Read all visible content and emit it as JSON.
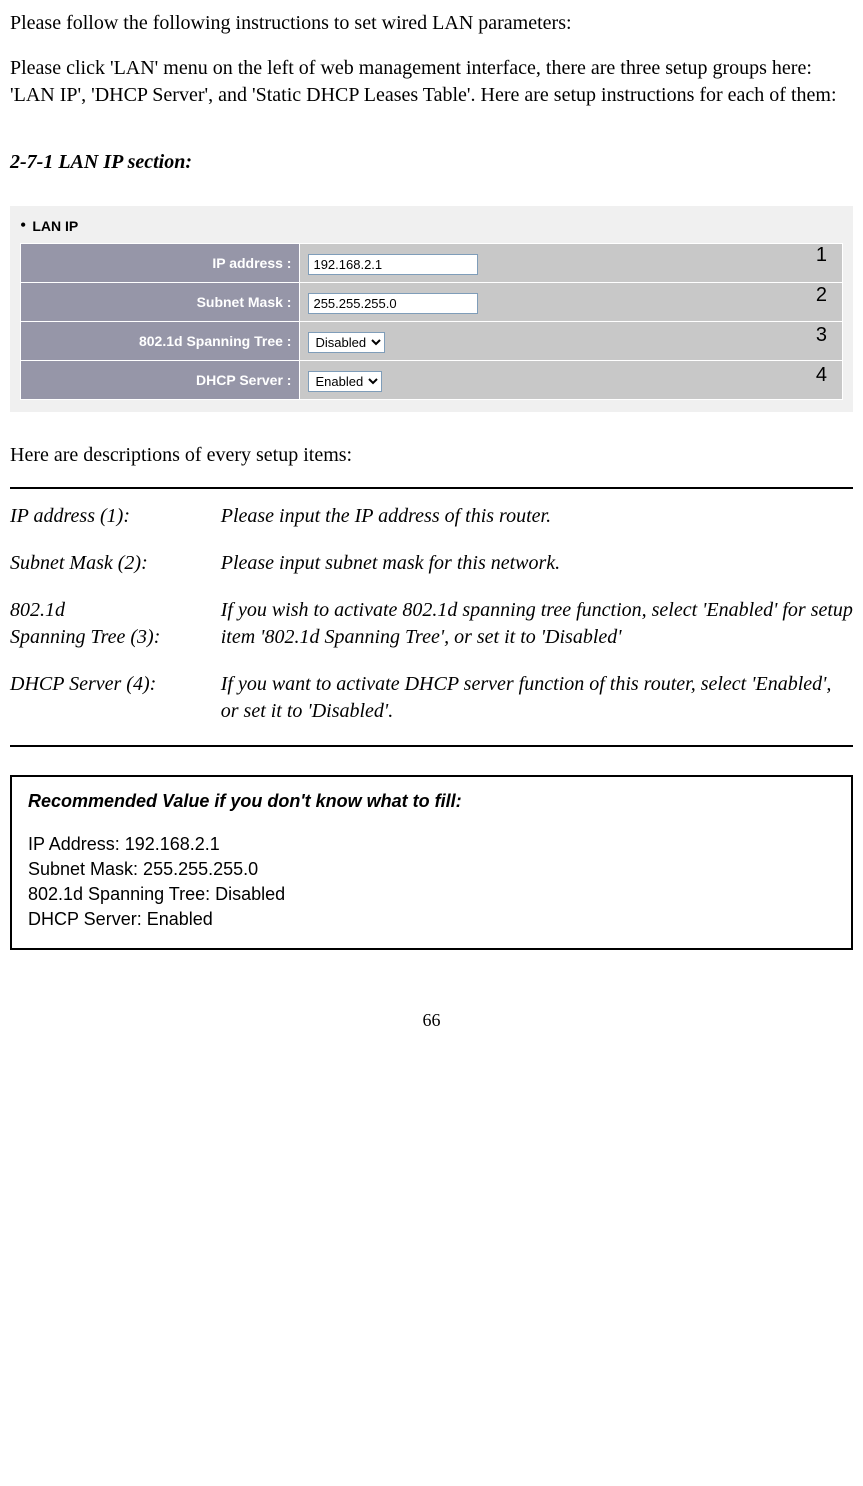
{
  "intro1": "Please follow the following instructions to set wired LAN parameters:",
  "intro2": "Please click 'LAN' menu on the left of web management interface, there are three setup groups here: 'LAN IP', 'DHCP Server', and 'Static DHCP Leases Table'. Here are setup instructions for each of them:",
  "section_heading": "2-7-1 LAN IP section:",
  "screenshot": {
    "heading": "LAN IP",
    "rows": [
      {
        "label": "IP address :",
        "type": "text",
        "value": "192.168.2.1"
      },
      {
        "label": "Subnet Mask :",
        "type": "text",
        "value": "255.255.255.0"
      },
      {
        "label": "802.1d Spanning Tree :",
        "type": "select",
        "value": "Disabled"
      },
      {
        "label": "DHCP Server :",
        "type": "select",
        "value": "Enabled"
      }
    ],
    "annotations": [
      "1",
      "2",
      "3",
      "4"
    ]
  },
  "desc_intro": "Here are descriptions of every setup items:",
  "descriptions": [
    {
      "term": "IP address (1):",
      "def": "Please input the IP address of this router."
    },
    {
      "term": "Subnet Mask (2):",
      "def": "Please input subnet mask for this network."
    },
    {
      "term_line1": "802.1d",
      "term_line2": "Spanning Tree (3):",
      "def": "If you wish to activate 802.1d spanning tree function, select 'Enabled' for setup item '802.1d Spanning Tree', or set it to 'Disabled'"
    },
    {
      "term": "DHCP Server (4):",
      "def": "If you want to activate DHCP server function of this router, select 'Enabled', or set it to 'Disabled'."
    }
  ],
  "recbox": {
    "heading": "Recommended Value if you don't know what to fill:",
    "lines": [
      "IP Address: 192.168.2.1",
      "Subnet Mask: 255.255.255.0",
      "802.1d Spanning Tree: Disabled",
      "DHCP Server: Enabled"
    ]
  },
  "page_number": "66"
}
